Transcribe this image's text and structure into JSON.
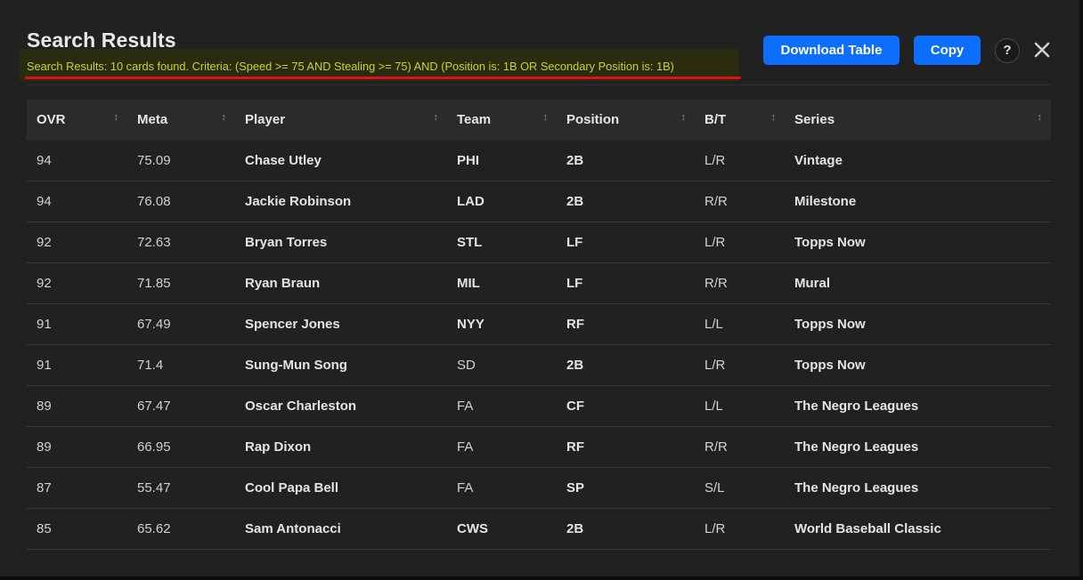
{
  "modal": {
    "title": "Search Results",
    "criteria": "Search Results: 10 cards found. Criteria: (Speed >= 75 AND Stealing >= 75) AND (Position is: 1B OR Secondary Position is: 1B)",
    "download_label": "Download Table",
    "copy_label": "Copy",
    "help_label": "?",
    "close_icon": "close-icon",
    "accent_color": "#0d6efd",
    "highlight_text_color": "#cbd133",
    "underline_color": "#e0101a"
  },
  "table": {
    "columns": [
      "OVR",
      "Meta",
      "Player",
      "Team",
      "Position",
      "B/T",
      "Series"
    ],
    "sort_icon": "sort-arrows-icon",
    "rows": [
      {
        "ovr": "94",
        "meta": "75.09",
        "player": "Chase Utley",
        "team": "PHI",
        "position": "2B",
        "bt": "L/R",
        "series": "Vintage"
      },
      {
        "ovr": "94",
        "meta": "76.08",
        "player": "Jackie Robinson",
        "team": "LAD",
        "position": "2B",
        "bt": "R/R",
        "series": "Milestone"
      },
      {
        "ovr": "92",
        "meta": "72.63",
        "player": "Bryan Torres",
        "team": "STL",
        "position": "LF",
        "bt": "L/R",
        "series": "Topps Now"
      },
      {
        "ovr": "92",
        "meta": "71.85",
        "player": "Ryan Braun",
        "team": "MIL",
        "position": "LF",
        "bt": "R/R",
        "series": "Mural"
      },
      {
        "ovr": "91",
        "meta": "67.49",
        "player": "Spencer Jones",
        "team": "NYY",
        "position": "RF",
        "bt": "L/L",
        "series": "Topps Now"
      },
      {
        "ovr": "91",
        "meta": "71.4",
        "player": "Sung-Mun Song",
        "team": "SD",
        "position": "2B",
        "bt": "L/R",
        "series": "Topps Now"
      },
      {
        "ovr": "89",
        "meta": "67.47",
        "player": "Oscar Charleston",
        "team": "FA",
        "position": "CF",
        "bt": "L/L",
        "series": "The Negro Leagues"
      },
      {
        "ovr": "89",
        "meta": "66.95",
        "player": "Rap Dixon",
        "team": "FA",
        "position": "RF",
        "bt": "R/R",
        "series": "The Negro Leagues"
      },
      {
        "ovr": "87",
        "meta": "55.47",
        "player": "Cool Papa Bell",
        "team": "FA",
        "position": "SP",
        "bt": "S/L",
        "series": "The Negro Leagues"
      },
      {
        "ovr": "85",
        "meta": "65.62",
        "player": "Sam Antonacci",
        "team": "CWS",
        "position": "2B",
        "bt": "L/R",
        "series": "World Baseball Classic"
      }
    ]
  }
}
